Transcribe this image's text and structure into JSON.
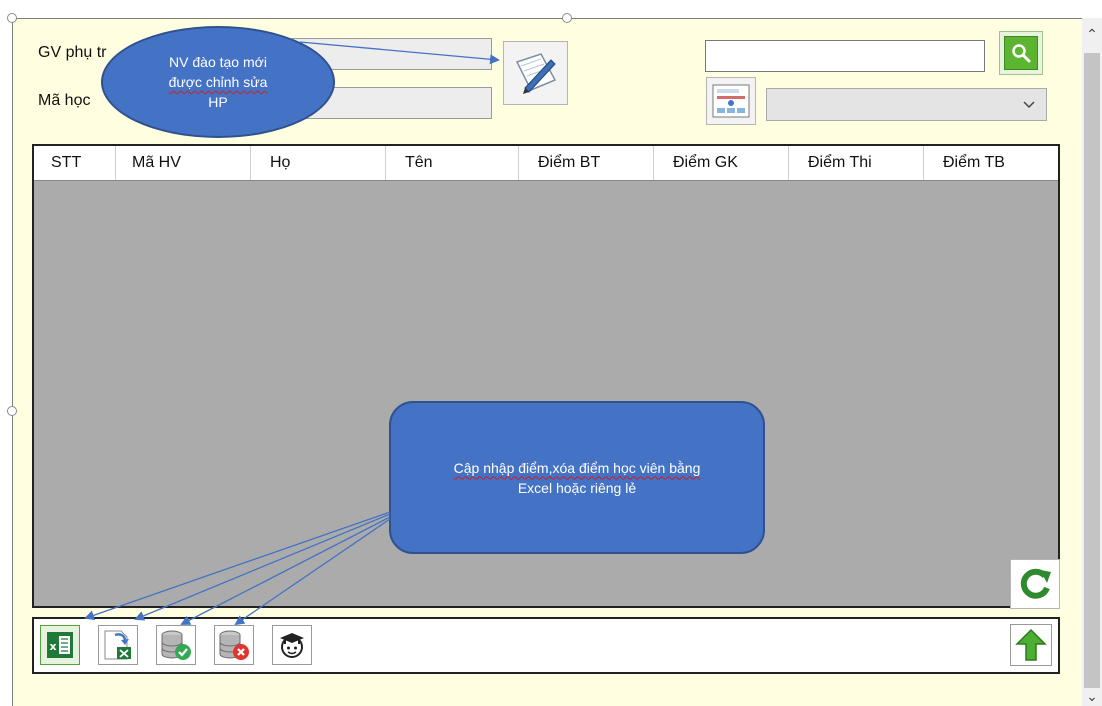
{
  "form": {
    "gv_label": "GV phụ tr",
    "mahoc_label": "Mã học"
  },
  "filter": {
    "search_value": "",
    "select_value": ""
  },
  "table": {
    "columns": [
      "STT",
      "Mã HV",
      "Họ",
      "Tên",
      "Điểm BT",
      "Điểm GK",
      "Điểm Thi",
      "Điểm TB"
    ],
    "rows": []
  },
  "annotations": {
    "ellipse_lines": [
      "NV đào tạo mới",
      "được chỉnh sửa",
      "HP"
    ],
    "rect_lines": [
      "Cập nhập điểm,xóa điểm học viên bằng",
      "Excel hoặc riêng lẻ"
    ]
  },
  "icons": {
    "edit": "edit-pencil-icon",
    "search": "search-icon",
    "filter": "filter-form-icon",
    "refresh": "refresh-icon",
    "excel": "excel-icon",
    "import": "import-excel-icon",
    "db_save": "database-save-icon",
    "db_delete": "database-delete-icon",
    "student": "student-icon",
    "upload": "upload-arrow-icon"
  },
  "colors": {
    "panel_bg": "#fffee0",
    "grid_bg": "#ababab",
    "callout": "#4472c4",
    "search_button": "#5cb531",
    "arrow": "#4472c4"
  }
}
